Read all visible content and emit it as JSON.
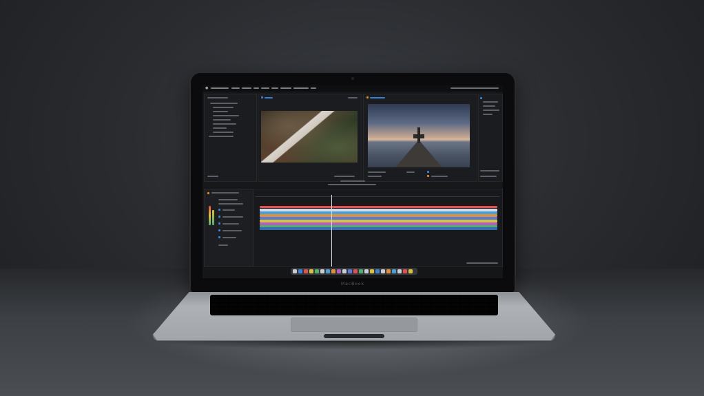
{
  "scene": {
    "device": "laptop",
    "app": "video-editor"
  },
  "colors": {
    "accent": "#3a82d8",
    "highlight": "#e08a2a",
    "track_colors": [
      "#e05050",
      "#e0903a",
      "#d8c040",
      "#4aa0d8",
      "#5a7ad8",
      "#b060c0",
      "#50b070"
    ]
  },
  "laptop": {
    "brand_label": "MacBook"
  },
  "icons": [
    "apple-icon",
    "play-icon",
    "folder-icon",
    "dock-app-icon"
  ]
}
